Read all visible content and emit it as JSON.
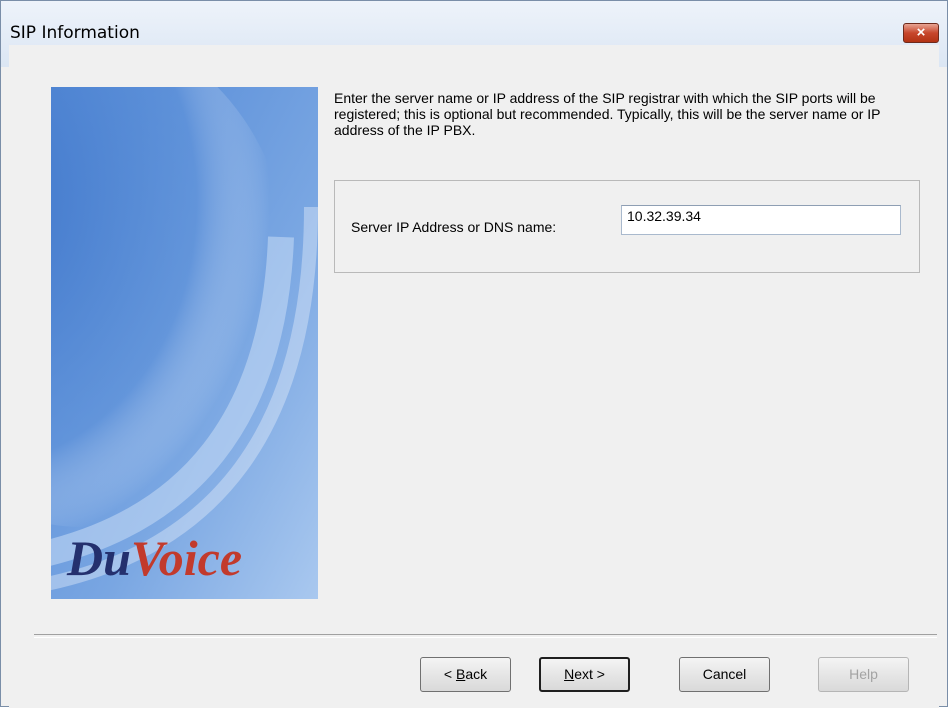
{
  "window": {
    "title": "SIP Information",
    "close_label": "×"
  },
  "logo": {
    "text": "DuVoice"
  },
  "instructions": "Enter the server name or IP address of the SIP registrar with which the SIP ports will be registered; this is optional but recommended.  Typically, this will be the server name or IP address of the IP PBX.",
  "server": {
    "label": "Server IP Address or DNS name:",
    "value": "10.32.39.34"
  },
  "buttons": {
    "back_prefix": "< ",
    "back_mnemonic": "B",
    "back_rest": "ack",
    "next_mnemonic": "N",
    "next_rest": "ext >",
    "cancel": "Cancel",
    "help": "Help"
  },
  "colors": {
    "panel_blue": "#6b9ad9",
    "logo_dark": "#24306e",
    "logo_red": "#c23a2c"
  }
}
